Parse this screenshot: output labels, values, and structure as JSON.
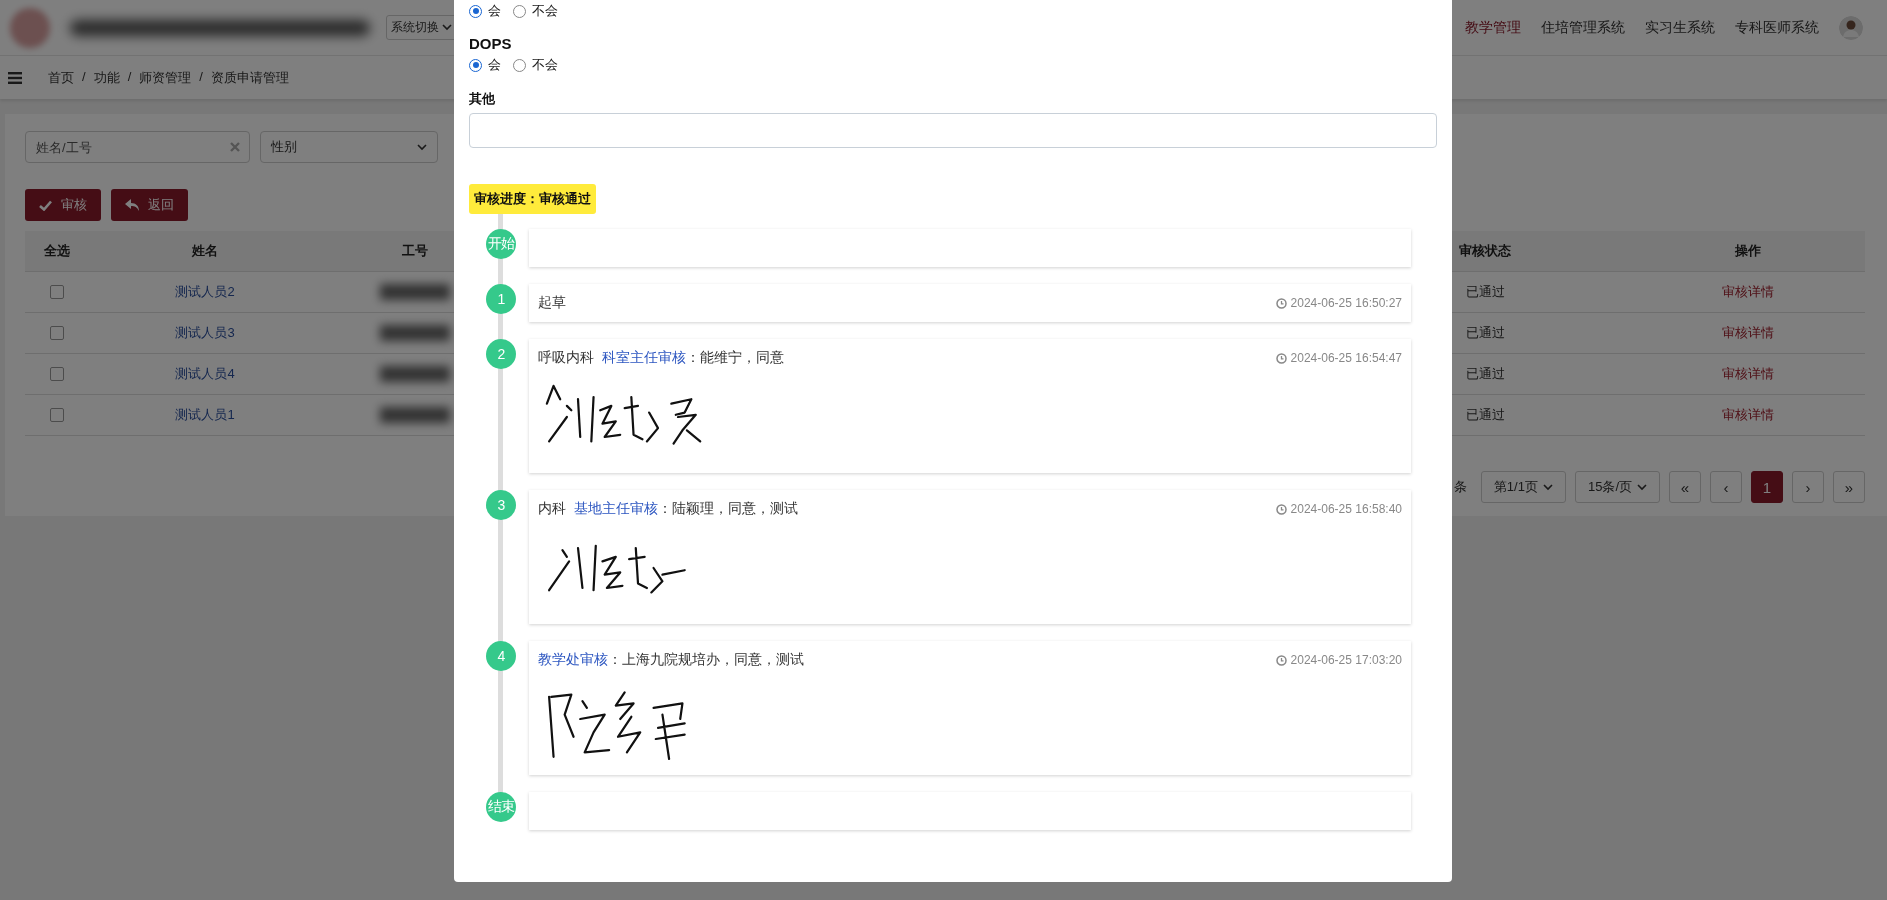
{
  "header": {
    "system_switch": "系统切换",
    "nav": [
      {
        "label": "教学管理",
        "selected": true
      },
      {
        "label": "住培管理系统",
        "selected": false
      },
      {
        "label": "实习生系统",
        "selected": false
      },
      {
        "label": "专科医师系统",
        "selected": false
      }
    ]
  },
  "breadcrumb": {
    "separator": "/",
    "items": [
      "首页",
      "功能",
      "师资管理",
      "资质申请管理"
    ]
  },
  "filters": {
    "name_field": {
      "placeholder": "姓名/工号"
    },
    "gender_select": "性别"
  },
  "actions": [
    {
      "label": "审核"
    },
    {
      "label": "返回"
    }
  ],
  "table": {
    "columns": [
      "全选",
      "姓名",
      "工号",
      "",
      "审核状态",
      "",
      "操作"
    ],
    "rows": [
      {
        "checked": false,
        "name": "测试人员2",
        "status": "已通过",
        "action": "审核详情"
      },
      {
        "checked": false,
        "name": "测试人员3",
        "status": "已通过",
        "action": "审核详情"
      },
      {
        "checked": false,
        "name": "测试人员4",
        "status": "已通过",
        "action": "审核详情"
      },
      {
        "checked": false,
        "name": "测试人员1",
        "status": "已通过",
        "action": "审核详情"
      }
    ]
  },
  "pagination": {
    "total": "条",
    "page_select": "第1/1页",
    "size_select": "15条/页",
    "prev_buttons": [
      "«",
      "‹"
    ],
    "pages": [
      {
        "label": "1",
        "selected": true
      }
    ],
    "next_buttons": [
      "›",
      "»"
    ]
  },
  "modal": {
    "questions": [
      {
        "options": [
          {
            "label": "会",
            "selected": true
          },
          {
            "label": "不会",
            "selected": false
          }
        ]
      },
      {
        "title": "DOPS",
        "options": [
          {
            "label": "会",
            "selected": true
          },
          {
            "label": "不会",
            "selected": false
          }
        ]
      }
    ],
    "other": {
      "label": "其他"
    },
    "progress": "审核进度：审核通过",
    "timeline": [
      {
        "kind": "end_marker",
        "marker": "开始"
      },
      {
        "kind": "step",
        "marker": "1",
        "text": "起草",
        "time": "2024-06-25 16:50:27",
        "signed": false
      },
      {
        "kind": "step",
        "marker": "2",
        "dept": "呼吸内科",
        "role": "科室主任审核",
        "comment": "：能维宁，同意",
        "time": "2024-06-25 16:54:47",
        "signed": true
      },
      {
        "kind": "step",
        "marker": "3",
        "dept": "内科",
        "role": "基地主任审核",
        "comment": "：陆颖理，同意，测试",
        "time": "2024-06-25 16:58:40",
        "signed": true
      },
      {
        "kind": "step",
        "marker": "4",
        "role": "教学处审核",
        "comment": "：上海九院规培办，同意，测试",
        "time": "2024-06-25 17:03:20",
        "signed": true
      },
      {
        "kind": "end_marker",
        "marker": "结束"
      }
    ]
  }
}
